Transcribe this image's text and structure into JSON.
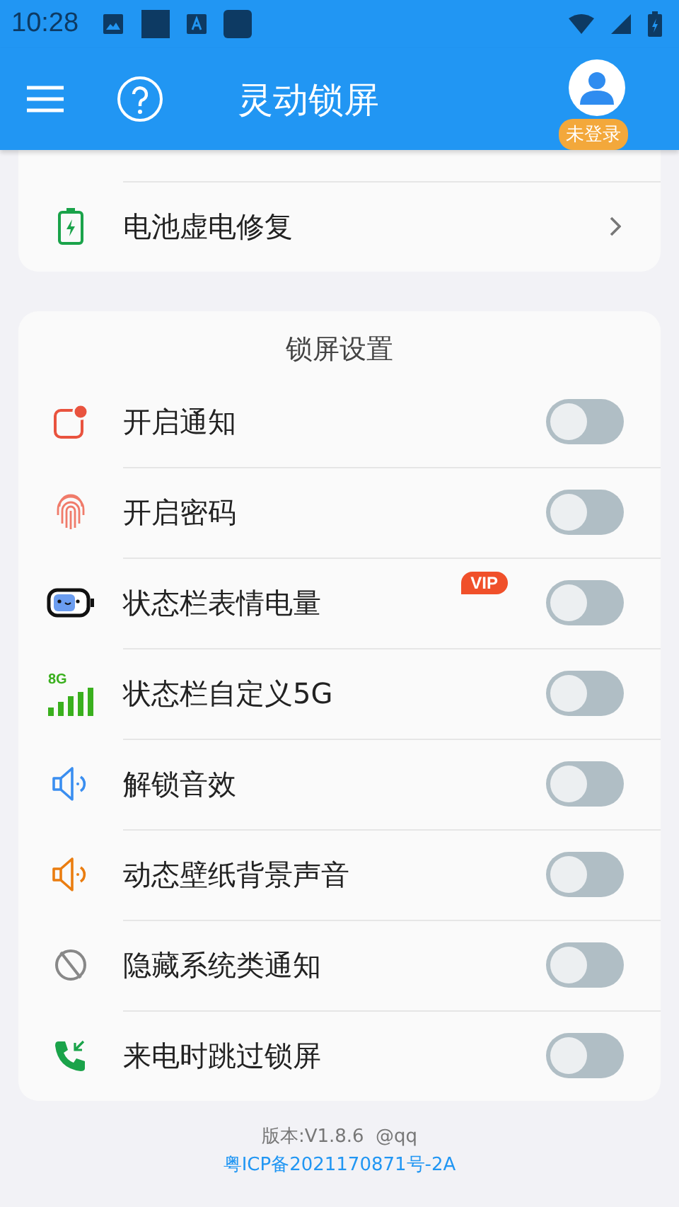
{
  "status_bar": {
    "time": "10:28"
  },
  "header": {
    "title": "灵动锁屏",
    "login_badge": "未登录"
  },
  "tools": [
    {
      "kind": "battery",
      "label": "电池虚电修复"
    }
  ],
  "lock_settings": {
    "title": "锁屏设置",
    "items": [
      {
        "kind": "notify",
        "label": "开启通知",
        "on": false
      },
      {
        "kind": "fingerprint",
        "label": "开启密码",
        "on": false
      },
      {
        "kind": "face-battery",
        "label": "状态栏表情电量",
        "on": false,
        "badge": "VIP"
      },
      {
        "kind": "signal",
        "icon_text": "8G",
        "label": "状态栏自定义5G",
        "on": false
      },
      {
        "kind": "speaker-blue",
        "label": "解锁音效",
        "on": false
      },
      {
        "kind": "speaker-orange",
        "label": "动态壁纸背景声音",
        "on": false
      },
      {
        "kind": "hide",
        "label": "隐藏系统类通知",
        "on": false
      },
      {
        "kind": "call",
        "label": "来电时跳过锁屏",
        "on": false
      }
    ]
  },
  "footer": {
    "version": "版本:V1.8.6  @qq",
    "icp": "粤ICP备2021170871号-2A"
  }
}
